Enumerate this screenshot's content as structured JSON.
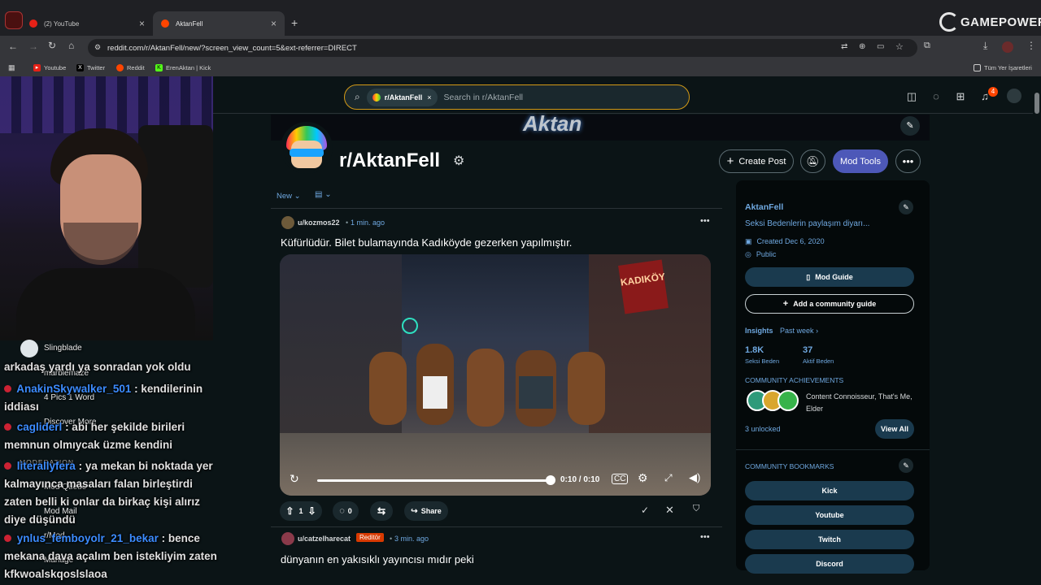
{
  "browser": {
    "tabs": [
      {
        "label": "(2) YouTube"
      },
      {
        "label": "AktanFell"
      }
    ],
    "url": "reddit.com/r/AktanFell/new/?screen_view_count=5&ext-referrer=DIRECT",
    "bookmarks": [
      "Youtube",
      "Twitter",
      "Reddit",
      "ErenAktan | Kick"
    ],
    "bookmarks_right": "Tüm Yer İşaretleri",
    "watermark": "GAMEPOWER"
  },
  "reddit": {
    "search_chip": "r/AktanFell",
    "search_placeholder": "Search in r/AktanFell",
    "notification_count": "4",
    "subreddit_title": "r/AktanFell",
    "create_post": "Create Post",
    "mod_tools": "Mod Tools",
    "sort_label": "New",
    "posts": [
      {
        "author": "u/kozmos22",
        "time": "1 min. ago",
        "title": "Küfürlüdür. Bilet bulamayında Kadıköyde gezerken yapılmıştır.",
        "video_time": "0:10 / 0:10",
        "votes": "1",
        "comments": "0",
        "share": "Share"
      },
      {
        "author": "u/catzelharecat",
        "flair": "Reditör",
        "time": "3 min. ago",
        "title": "dünyanın en yakısıklı yayıncısı mıdır peki"
      }
    ],
    "sidebar": {
      "name": "AktanFell",
      "description": "Seksi Bedenlerin paylaşım diyarı...",
      "created": "Created Dec 6, 2020",
      "visibility": "Public",
      "mod_guide": "Mod Guide",
      "add_guide": "Add a community guide",
      "insights": "Insights",
      "insights_period": "Past week",
      "stat1_value": "1.8K",
      "stat1_label": "Seksi Beden",
      "stat2_value": "37",
      "stat2_label": "Aktif Beden",
      "achievements_heading": "COMMUNITY ACHIEVEMENTS",
      "achievements_text": "Content Connoisseur, That's Me, Elder",
      "unlocked": "3 unlocked",
      "view_all": "View All",
      "bookmarks_heading": "COMMUNITY BOOKMARKS",
      "bookmarks": [
        "Kick",
        "Youtube",
        "Twitch",
        "Discord"
      ]
    }
  },
  "overlay": {
    "menu": [
      {
        "label": "Slingblade"
      },
      {
        "label": "marblemaze"
      },
      {
        "label": "4 Pics 1 Word"
      },
      {
        "label": "Discover More"
      },
      {
        "label": "MODERATION"
      },
      {
        "label": "Mod Queue"
      },
      {
        "label": "Mod Mail"
      },
      {
        "label": "r/Mod"
      },
      {
        "label": "Manage"
      }
    ],
    "chat": [
      {
        "text": "arkadaş yardı ya sonradan yok oldu"
      },
      {
        "user": "AnakinSkywalker_501",
        "text": ": kendilerinin iddiası"
      },
      {
        "user": "cagliderl",
        "text": ": abi her şekilde birileri memnun olmıycak üzme kendini"
      },
      {
        "user": "literallyfera",
        "text": ": ya mekan bi noktada yer kalmayınca masaları falan birleştirdi zaten belli ki onlar da birkaç kişi alırız diye düşündü"
      },
      {
        "user": "ynlus_femboyolr_21_bekar",
        "text": ": bence mekana dava açalım ben istekliyim zaten kfkwoalskqoslslaoa"
      }
    ]
  }
}
